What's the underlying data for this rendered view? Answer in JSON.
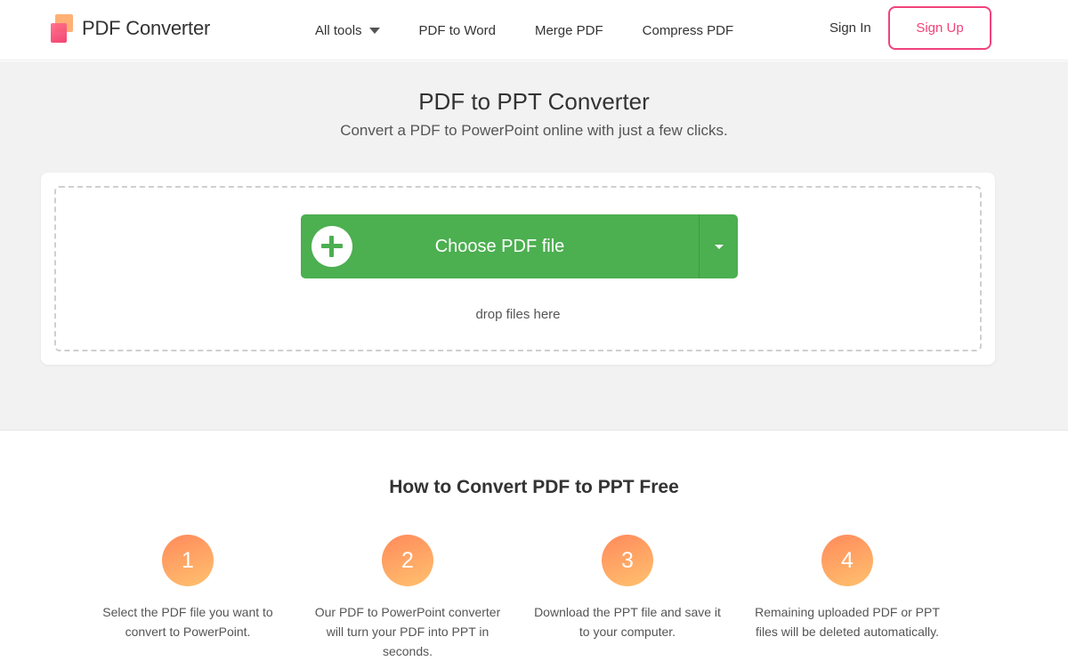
{
  "header": {
    "logo_text": "PDF Converter",
    "nav": [
      {
        "label": "All tools",
        "has_caret": true
      },
      {
        "label": "PDF to Word"
      },
      {
        "label": "Merge PDF"
      },
      {
        "label": "Compress PDF"
      }
    ],
    "sign_in": "Sign In",
    "sign_up": "Sign Up"
  },
  "hero": {
    "title": "PDF to PPT Converter",
    "subtitle": "Convert a PDF to PowerPoint online with just a few clicks.",
    "choose_button": "Choose PDF file",
    "drop_text": "drop files here"
  },
  "how_to": {
    "title": "How to Convert PDF to PPT Free",
    "steps": [
      {
        "number": "1",
        "text": "Select the PDF file you want to convert to PowerPoint."
      },
      {
        "number": "2",
        "text": "Our PDF to PowerPoint converter will turn your PDF into PPT in seconds."
      },
      {
        "number": "3",
        "text": "Download the PPT file and save it to your computer."
      },
      {
        "number": "4",
        "text": "Remaining uploaded PDF or PPT files will be deleted automatically."
      }
    ]
  },
  "colors": {
    "accent_pink": "#f0437a",
    "button_green": "#4caf50",
    "step_gradient_start": "#ff8a5c",
    "step_gradient_end": "#ffc16e",
    "hero_background": "#f2f2f2"
  },
  "icons": {
    "logo": "stacked-squares-logo-icon",
    "all_tools_caret": "caret-down-icon",
    "choose_plus": "plus-circle-icon",
    "choose_dropdown": "caret-down-icon"
  }
}
